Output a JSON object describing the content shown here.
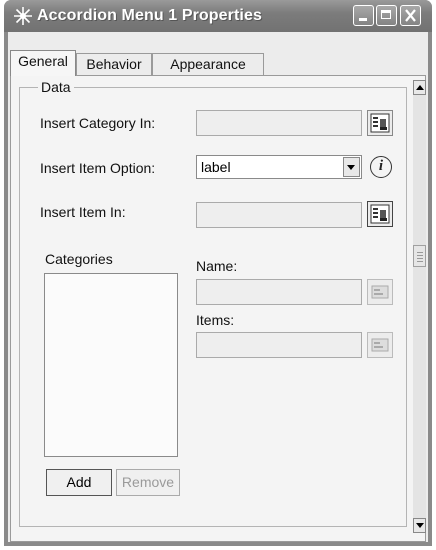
{
  "window": {
    "title": "Accordion Menu 1 Properties",
    "icon": "star-burst-icon"
  },
  "title_buttons": [
    "minimize-icon",
    "maximize-icon",
    "close-icon"
  ],
  "tabs": [
    {
      "label": "General",
      "active": true
    },
    {
      "label": "Behavior",
      "active": false
    },
    {
      "label": "Appearance",
      "active": false
    }
  ],
  "data_group": {
    "legend": "Data",
    "insert_category_in": {
      "label": "Insert Category In:",
      "value": "",
      "enabled": false
    },
    "insert_item_option": {
      "label": "Insert Item Option:",
      "value": "label"
    },
    "insert_item_in": {
      "label": "Insert Item In:",
      "value": "",
      "enabled": false
    },
    "categories": {
      "label": "Categories",
      "items": []
    },
    "name": {
      "label": "Name:",
      "value": "",
      "enabled": false
    },
    "items": {
      "label": "Items:",
      "value": "",
      "enabled": false
    },
    "add_button": "Add",
    "remove_button": "Remove"
  },
  "colors": {
    "titlebar": "#7c7c7c",
    "panel": "#f4f4f4",
    "border": "#8a8a8a"
  }
}
